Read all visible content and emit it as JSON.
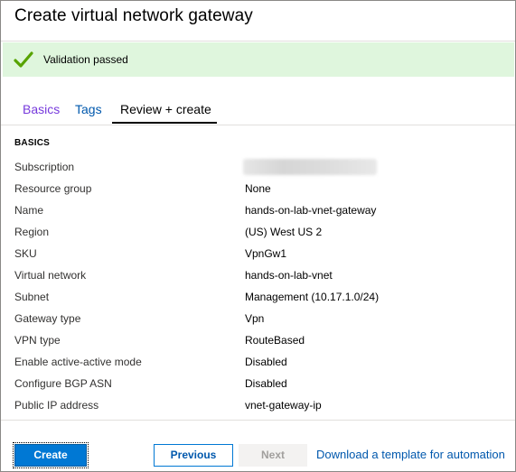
{
  "header": {
    "title": "Create virtual network gateway"
  },
  "banner": {
    "message": "Validation passed",
    "icon": "checkmark-icon",
    "color": "#dff6dd"
  },
  "tabs": [
    {
      "label": "Basics"
    },
    {
      "label": "Tags"
    },
    {
      "label": "Review + create",
      "selected": true
    }
  ],
  "section": {
    "heading": "BASICS"
  },
  "fields": [
    {
      "label": "Subscription",
      "value": ""
    },
    {
      "label": "Resource group",
      "value": "None"
    },
    {
      "label": "Name",
      "value": "hands-on-lab-vnet-gateway"
    },
    {
      "label": "Region",
      "value": "(US) West US 2"
    },
    {
      "label": "SKU",
      "value": "VpnGw1"
    },
    {
      "label": "Virtual network",
      "value": "hands-on-lab-vnet"
    },
    {
      "label": "Subnet",
      "value": "Management (10.17.1.0/24)"
    },
    {
      "label": "Gateway type",
      "value": "Vpn"
    },
    {
      "label": "VPN type",
      "value": "RouteBased"
    },
    {
      "label": "Enable active-active mode",
      "value": "Disabled"
    },
    {
      "label": "Configure BGP ASN",
      "value": "Disabled"
    },
    {
      "label": "Public IP address",
      "value": "vnet-gateway-ip"
    }
  ],
  "footer": {
    "create_label": "Create",
    "previous_label": "Previous",
    "next_label": "Next",
    "download_link": "Download a template for automation"
  },
  "colors": {
    "accent": "#0078d4",
    "link": "#0058ad",
    "visited_tab": "#773adc"
  }
}
